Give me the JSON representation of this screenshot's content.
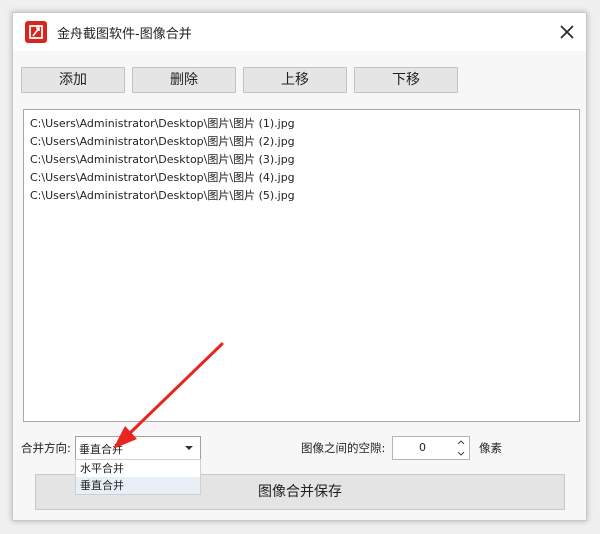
{
  "window": {
    "title": "金舟截图软件-图像合并"
  },
  "toolbar": {
    "add_label": "添加",
    "delete_label": "删除",
    "move_up_label": "上移",
    "move_down_label": "下移"
  },
  "files": [
    "C:\\Users\\Administrator\\Desktop\\图片\\图片 (1).jpg",
    "C:\\Users\\Administrator\\Desktop\\图片\\图片 (2).jpg",
    "C:\\Users\\Administrator\\Desktop\\图片\\图片 (3).jpg",
    "C:\\Users\\Administrator\\Desktop\\图片\\图片 (4).jpg",
    "C:\\Users\\Administrator\\Desktop\\图片\\图片 (5).jpg"
  ],
  "merge": {
    "direction_label": "合并方向:",
    "direction_value": "垂直合并",
    "options": [
      "水平合并",
      "垂直合并"
    ],
    "gap_label": "图像之间的空隙:",
    "gap_value": "0",
    "gap_unit": "像素"
  },
  "save_label": "图像合并保存",
  "colors": {
    "annotation_arrow": "#e8251f",
    "app_icon": "#d9251d",
    "selected_option_bg": "#e8eff7"
  }
}
